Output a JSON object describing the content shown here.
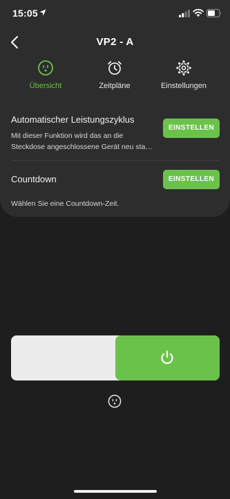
{
  "status_bar": {
    "time": "15:05"
  },
  "header": {
    "title": "VP2 - A"
  },
  "tabs": [
    {
      "label": "Übersicht",
      "icon": "outlet-icon",
      "active": true
    },
    {
      "label": "Zeitpläne",
      "icon": "alarm-clock-icon",
      "active": false
    },
    {
      "label": "Einstellungen",
      "icon": "gear-icon",
      "active": false
    }
  ],
  "features": [
    {
      "title": "Automatischer Leistungszyklus",
      "description": "Mit dieser Funktion wird das an die Steckdose angeschlossene Gerät neu sta…",
      "button_label": "EINSTELLEN"
    },
    {
      "title": "Countdown",
      "description": "Wählen Sie eine Countdown-Zeit.",
      "button_label": "EINSTELLEN"
    }
  ],
  "power_switch": {
    "state": "on",
    "icon": "power-icon"
  },
  "colors": {
    "accent": "#6bc24a",
    "panel": "#2d2d2d",
    "background": "#1e1e1e",
    "track": "#ececec"
  }
}
